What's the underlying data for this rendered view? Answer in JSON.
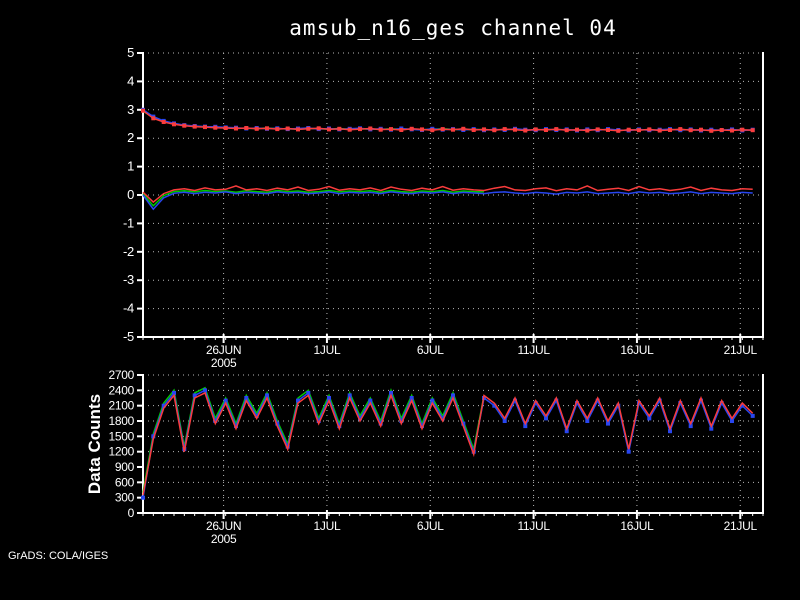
{
  "title": "amsub_n16_ges channel 04",
  "footer": "GrADS: COLA/IGES",
  "colors": {
    "background": "#000000",
    "axis": "#ffffff",
    "grid": "#b8b8b8",
    "text": "#ffffff",
    "red": "#fa3c3c",
    "green": "#00c800",
    "blue": "#2846f0"
  },
  "x_axis": {
    "xlim": [
      0,
      30
    ],
    "minor_tick_step": 0.5,
    "ticks": [
      {
        "label": "26JUN",
        "sub": "2005",
        "day": 3.9
      },
      {
        "label": "1JUL",
        "day": 8.9
      },
      {
        "label": "6JUL",
        "day": 13.9
      },
      {
        "label": "11JUL",
        "day": 18.9
      },
      {
        "label": "16JUL",
        "day": 23.9
      },
      {
        "label": "21JUL",
        "day": 28.9
      }
    ]
  },
  "chart_data": [
    {
      "type": "line",
      "name": "bias-stdev-panel",
      "ylim": [
        -5,
        5
      ],
      "ytick_step": 1,
      "grid": true,
      "series": [
        {
          "name": "stdev-green",
          "color": "green",
          "markers": false,
          "x_start": 0,
          "x_step": 0.5,
          "values": [
            2.95,
            2.73,
            2.59,
            2.5,
            2.45,
            2.42,
            2.4,
            2.38,
            2.37,
            2.35,
            2.35,
            2.34,
            2.36,
            2.33,
            2.33,
            2.32,
            2.34,
            2.33,
            2.32,
            2.34,
            2.31,
            2.33,
            2.32,
            2.31,
            2.33,
            2.31,
            2.32,
            2.3,
            2.31,
            2.33,
            2.31,
            2.3,
            2.31,
            2.3
          ]
        },
        {
          "name": "stdev-blue",
          "color": "blue",
          "markers": true,
          "x_start": 0,
          "x_step": 0.5,
          "values": [
            3.0,
            2.76,
            2.61,
            2.52,
            2.46,
            2.43,
            2.41,
            2.4,
            2.38,
            2.37,
            2.34,
            2.36,
            2.33,
            2.35,
            2.32,
            2.34,
            2.36,
            2.32,
            2.34,
            2.31,
            2.33,
            2.35,
            2.31,
            2.33,
            2.3,
            2.34,
            2.31,
            2.29,
            2.33,
            2.3,
            2.32,
            2.29,
            2.32,
            2.28,
            2.31,
            2.29,
            2.33,
            2.3,
            2.28,
            2.32,
            2.29,
            2.31,
            2.27,
            2.31,
            2.28,
            2.32,
            2.29,
            2.27,
            2.31,
            2.28,
            2.3,
            2.32,
            2.28,
            2.31,
            2.27,
            2.3,
            2.28,
            2.31,
            2.27,
            2.3
          ]
        },
        {
          "name": "stdev-red",
          "color": "red",
          "markers": true,
          "x_start": 0,
          "x_step": 0.5,
          "values": [
            2.97,
            2.7,
            2.57,
            2.49,
            2.44,
            2.41,
            2.39,
            2.37,
            2.36,
            2.34,
            2.36,
            2.33,
            2.35,
            2.32,
            2.34,
            2.31,
            2.33,
            2.35,
            2.31,
            2.33,
            2.3,
            2.32,
            2.34,
            2.3,
            2.32,
            2.29,
            2.33,
            2.31,
            2.28,
            2.32,
            2.3,
            2.33,
            2.29,
            2.31,
            2.28,
            2.32,
            2.3,
            2.27,
            2.31,
            2.29,
            2.32,
            2.28,
            2.3,
            2.27,
            2.31,
            2.29,
            2.26,
            2.3,
            2.28,
            2.31,
            2.27,
            2.29,
            2.32,
            2.28,
            2.3,
            2.26,
            2.29,
            2.27,
            2.3,
            2.28
          ]
        },
        {
          "name": "bias-green",
          "color": "green",
          "markers": false,
          "x_start": 0,
          "x_step": 0.5,
          "values": [
            0.05,
            -0.38,
            -0.02,
            0.12,
            0.15,
            0.11,
            0.16,
            0.12,
            0.14,
            0.1,
            0.15,
            0.12,
            0.1,
            0.16,
            0.12,
            0.14,
            0.1,
            0.12,
            0.16,
            0.11,
            0.14,
            0.12,
            0.15,
            0.1,
            0.16,
            0.12,
            0.1,
            0.14,
            0.12,
            0.16,
            0.1,
            0.14,
            0.12,
            0.11
          ]
        },
        {
          "name": "bias-blue",
          "color": "blue",
          "markers": false,
          "x_start": 0,
          "x_step": 0.5,
          "values": [
            0.0,
            -0.5,
            -0.1,
            0.06,
            0.1,
            0.05,
            0.1,
            0.07,
            0.11,
            0.05,
            0.09,
            0.07,
            0.05,
            0.11,
            0.07,
            0.09,
            0.05,
            0.07,
            0.11,
            0.05,
            0.09,
            0.07,
            0.09,
            0.05,
            0.11,
            0.07,
            0.05,
            0.09,
            0.07,
            0.11,
            0.05,
            0.09,
            0.07,
            0.05,
            0.09,
            0.11,
            0.07,
            0.05,
            0.09,
            0.07,
            0.03,
            0.09,
            0.07,
            0.11,
            0.05,
            0.07,
            0.09,
            0.05,
            0.11,
            0.07,
            0.09,
            0.05,
            0.07,
            0.11,
            0.05,
            0.09,
            0.07,
            0.05,
            0.09,
            0.07
          ]
        },
        {
          "name": "bias-red",
          "color": "red",
          "markers": false,
          "x_start": 0,
          "x_step": 0.5,
          "values": [
            0.1,
            -0.25,
            0.05,
            0.18,
            0.22,
            0.16,
            0.25,
            0.18,
            0.2,
            0.32,
            0.18,
            0.22,
            0.16,
            0.24,
            0.18,
            0.28,
            0.16,
            0.2,
            0.3,
            0.17,
            0.22,
            0.18,
            0.25,
            0.16,
            0.28,
            0.2,
            0.16,
            0.24,
            0.18,
            0.3,
            0.17,
            0.22,
            0.18,
            0.16,
            0.24,
            0.3,
            0.18,
            0.16,
            0.22,
            0.25,
            0.15,
            0.22,
            0.18,
            0.32,
            0.16,
            0.2,
            0.24,
            0.16,
            0.3,
            0.18,
            0.22,
            0.16,
            0.2,
            0.28,
            0.16,
            0.24,
            0.18,
            0.16,
            0.22,
            0.2
          ]
        }
      ]
    },
    {
      "type": "line",
      "name": "data-counts-panel",
      "ylabel": "Data Counts",
      "ylim": [
        0,
        2700
      ],
      "ytick_step": 300,
      "grid": true,
      "series": [
        {
          "name": "counts-green",
          "color": "green",
          "markers": false,
          "x_start": 0,
          "x_step": 0.5,
          "values": [
            400,
            1550,
            2150,
            2400,
            1300,
            2350,
            2450,
            1850,
            2250,
            1750,
            2300,
            1950,
            2350,
            1800,
            1350,
            2250,
            2400,
            1850,
            2300,
            1750,
            2350,
            1900,
            2250,
            1800,
            2400,
            1850,
            2300,
            1750,
            2250,
            1900,
            2350,
            1800,
            1250,
            2300
          ]
        },
        {
          "name": "counts-blue",
          "color": "blue",
          "markers": true,
          "x_start": 0,
          "x_step": 0.5,
          "values": [
            300,
            1500,
            2100,
            2350,
            1250,
            2300,
            2400,
            1800,
            2200,
            1700,
            2250,
            1900,
            2300,
            1750,
            1300,
            2200,
            2350,
            1800,
            2250,
            1700,
            2300,
            1850,
            2200,
            1750,
            2350,
            1800,
            2250,
            1700,
            2200,
            1850,
            2300,
            1750,
            1200,
            2250,
            2100,
            1800,
            2200,
            1700,
            2150,
            1850,
            2200,
            1600,
            2150,
            1800,
            2200,
            1750,
            2100,
            1200,
            2150,
            1850,
            2200,
            1600,
            2150,
            1700,
            2200,
            1650,
            2150,
            1800,
            2100,
            1900
          ]
        },
        {
          "name": "counts-red",
          "color": "red",
          "markers": false,
          "x_start": 0,
          "x_step": 0.5,
          "values": [
            350,
            1450,
            2050,
            2300,
            1200,
            2250,
            2350,
            1750,
            2150,
            1650,
            2200,
            1850,
            2250,
            1700,
            1250,
            2150,
            2300,
            1750,
            2200,
            1650,
            2250,
            1800,
            2150,
            1700,
            2300,
            1750,
            2200,
            1650,
            2150,
            1800,
            2250,
            1700,
            1150,
            2300,
            2150,
            1850,
            2250,
            1750,
            2200,
            1900,
            2250,
            1650,
            2200,
            1850,
            2250,
            1800,
            2150,
            1250,
            2200,
            1900,
            2250,
            1650,
            2200,
            1750,
            2250,
            1700,
            2200,
            1850,
            2150,
            1950
          ]
        }
      ]
    }
  ]
}
